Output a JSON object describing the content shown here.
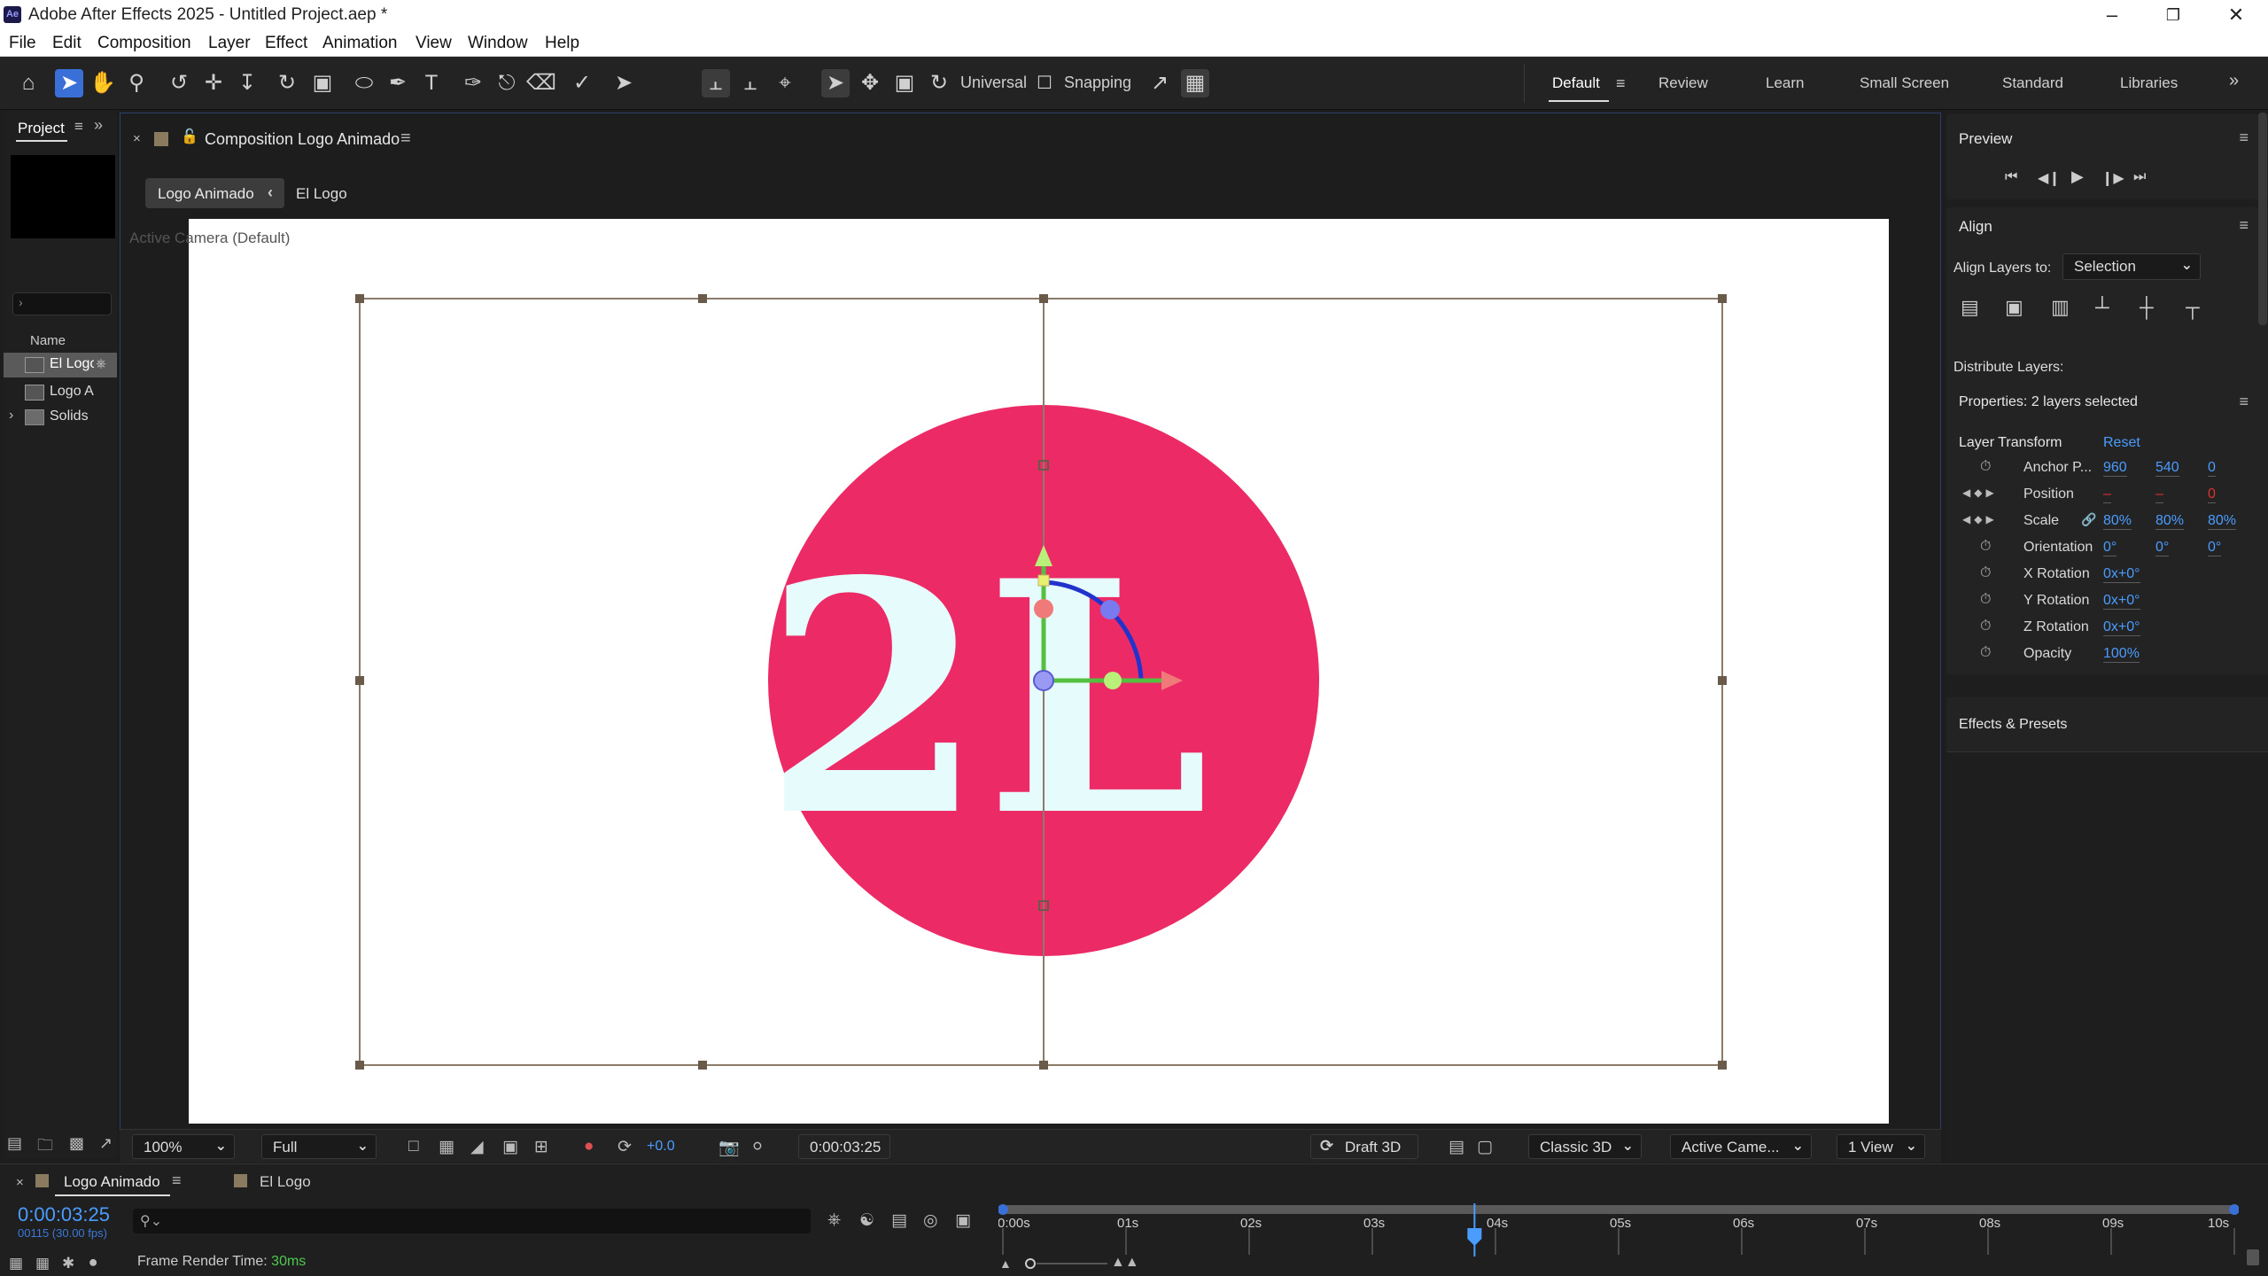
{
  "app": {
    "title": "Adobe After Effects 2025 - Untitled Project.aep *",
    "icon_label": "Ae",
    "accent": "#3a6fd8"
  },
  "menu": [
    "File",
    "Edit",
    "Composition",
    "Layer",
    "Effect",
    "Animation",
    "View",
    "Window",
    "Help"
  ],
  "toolbar": {
    "universal_label": "Universal",
    "snapping_label": "Snapping",
    "workspaces": [
      "Default",
      "Review",
      "Learn",
      "Small Screen",
      "Standard",
      "Libraries"
    ],
    "current_workspace": "Default"
  },
  "project": {
    "tab": "Project",
    "column_name": "Name",
    "search_value": "",
    "items": [
      {
        "label": "El Logo",
        "type": "composition",
        "selected": true
      },
      {
        "label": "Logo A",
        "type": "composition",
        "selected": false
      },
      {
        "label": "Solids",
        "type": "folder",
        "selected": false
      }
    ]
  },
  "composition": {
    "tab_title": "Composition Logo Animado",
    "breadcrumb": [
      "Logo Animado",
      "El Logo"
    ],
    "camera_label": "Active Camera (Default)",
    "logo_text": "2L",
    "logo_color": "#ec2b66",
    "logo_text_color": "#e6fbfb"
  },
  "viewer_footer": {
    "zoom": "100%",
    "resolution": "Full",
    "exposure": "+0.0",
    "timecode": "0:00:03:25",
    "renderer": "Draft 3D",
    "renderer_mode": "Classic 3D",
    "camera": "Active Came...",
    "views": "1 View"
  },
  "preview": {
    "title": "Preview"
  },
  "align": {
    "title": "Align",
    "align_to_label": "Align Layers to:",
    "align_to_value": "Selection",
    "distribute_label": "Distribute Layers:"
  },
  "properties": {
    "title": "Properties: 2 layers selected",
    "section": "Layer Transform",
    "reset": "Reset",
    "rows": [
      {
        "name": "Anchor P...",
        "values": [
          "960",
          "540",
          "0"
        ]
      },
      {
        "name": "Position",
        "values": [
          "–",
          "–",
          "0"
        ]
      },
      {
        "name": "Scale",
        "values": [
          "80%",
          "80%",
          "80%"
        ]
      },
      {
        "name": "Orientation",
        "values": [
          "0°",
          "0°",
          "0°"
        ]
      },
      {
        "name": "X Rotation",
        "values": [
          "0x+0°"
        ]
      },
      {
        "name": "Y Rotation",
        "values": [
          "0x+0°"
        ]
      },
      {
        "name": "Z Rotation",
        "values": [
          "0x+0°"
        ]
      },
      {
        "name": "Opacity",
        "values": [
          "100%"
        ]
      }
    ]
  },
  "effects": {
    "title": "Effects & Presets"
  },
  "timeline": {
    "tab_active": "Logo Animado",
    "tab_other": "El Logo",
    "timecode": "0:00:03:25",
    "frames": "00115 (30.00 fps)",
    "ticks": [
      "0:00s",
      "01s",
      "02s",
      "03s",
      "04s",
      "05s",
      "06s",
      "07s",
      "08s",
      "09s",
      "10s"
    ],
    "playhead_seconds": 3.83,
    "work_area_end_seconds": 10,
    "render_time_label": "Frame Render Time:",
    "render_time_value": "30ms"
  }
}
